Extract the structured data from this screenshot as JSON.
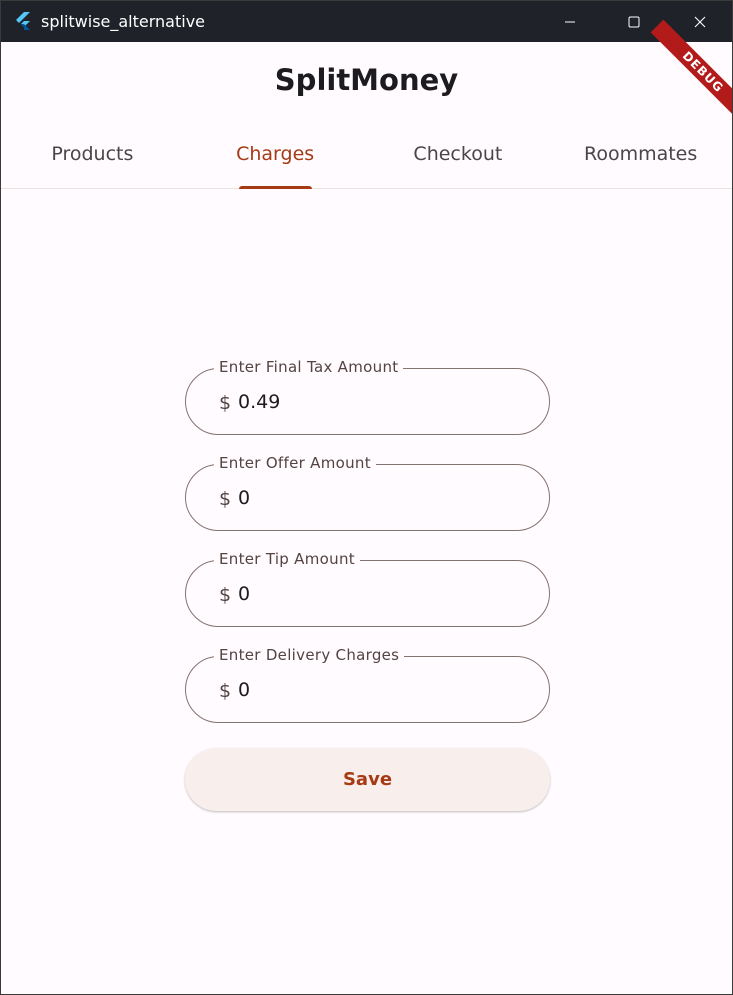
{
  "window": {
    "title": "splitwise_alternative",
    "icon": "flutter-logo-icon",
    "controls": [
      "minimize-icon",
      "maximize-icon",
      "close-icon"
    ]
  },
  "debug_banner": "DEBUG",
  "app": {
    "title": "SplitMoney"
  },
  "tabs": [
    {
      "label": "Products",
      "active": false
    },
    {
      "label": "Charges",
      "active": true
    },
    {
      "label": "Checkout",
      "active": false
    },
    {
      "label": "Roommates",
      "active": false
    }
  ],
  "form": {
    "fields": [
      {
        "label": "Enter Final Tax Amount",
        "prefix": "$",
        "value": "0.49"
      },
      {
        "label": "Enter Offer Amount",
        "prefix": "$",
        "value": "0"
      },
      {
        "label": "Enter Tip Amount",
        "prefix": "$",
        "value": "0"
      },
      {
        "label": "Enter Delivery Charges",
        "prefix": "$",
        "value": "0"
      }
    ],
    "save_label": "Save"
  },
  "colors": {
    "accent": "#a53a14",
    "titlebar": "#1f2229",
    "background": "#fffbfe",
    "outline": "#857370",
    "debug": "#b31b1b"
  }
}
